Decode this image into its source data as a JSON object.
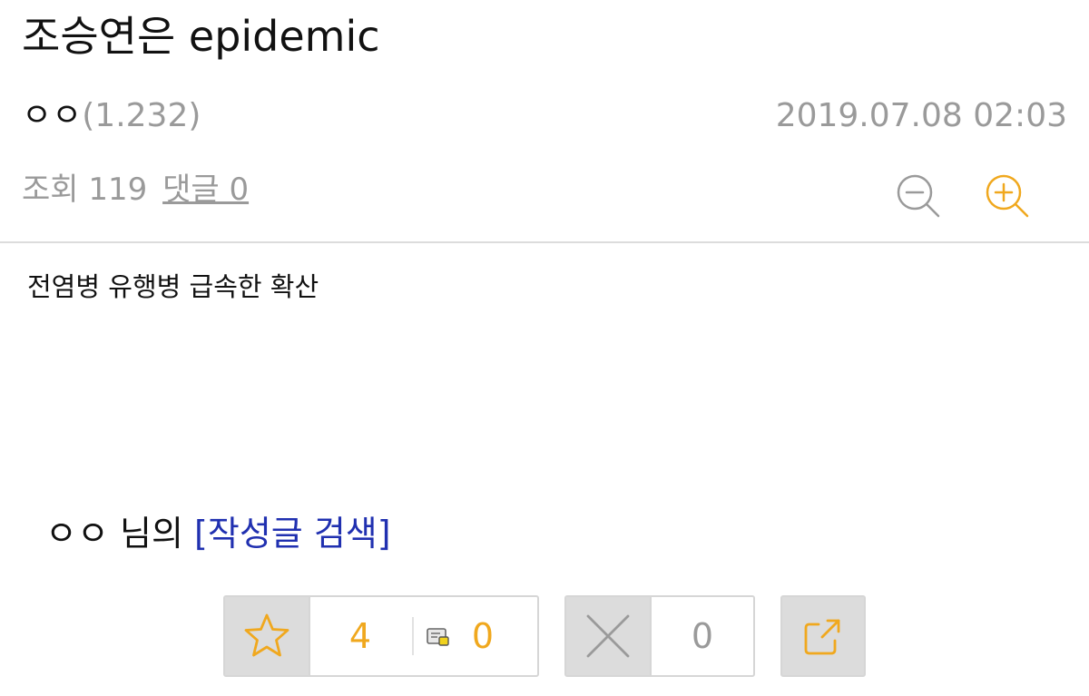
{
  "post": {
    "title": "조승연은 epidemic",
    "author": "ㅇㅇ",
    "author_level": "(1.232)",
    "date": "2019.07.08 02:03",
    "views_label": "조회 119",
    "comments_label": "댓글 0",
    "content": "전염병 유행병 급속한 확산"
  },
  "user_line": {
    "name": "ㅇㅇ",
    "suffix": "님의",
    "search_link": "[작성글 검색]"
  },
  "votes": {
    "recommend_count": "4",
    "scrap_count": "0",
    "oppose_count": "0"
  },
  "icons": {
    "zoom_out": "zoom-out-icon",
    "zoom_in": "zoom-in-icon",
    "recommend": "star-icon",
    "scrap": "scrap-icon",
    "oppose": "x-icon",
    "share": "share-icon"
  },
  "colors": {
    "accent": "#f0a81e",
    "link": "#2030b0",
    "muted": "#9a9a9a",
    "divider": "#dcdcdc"
  }
}
